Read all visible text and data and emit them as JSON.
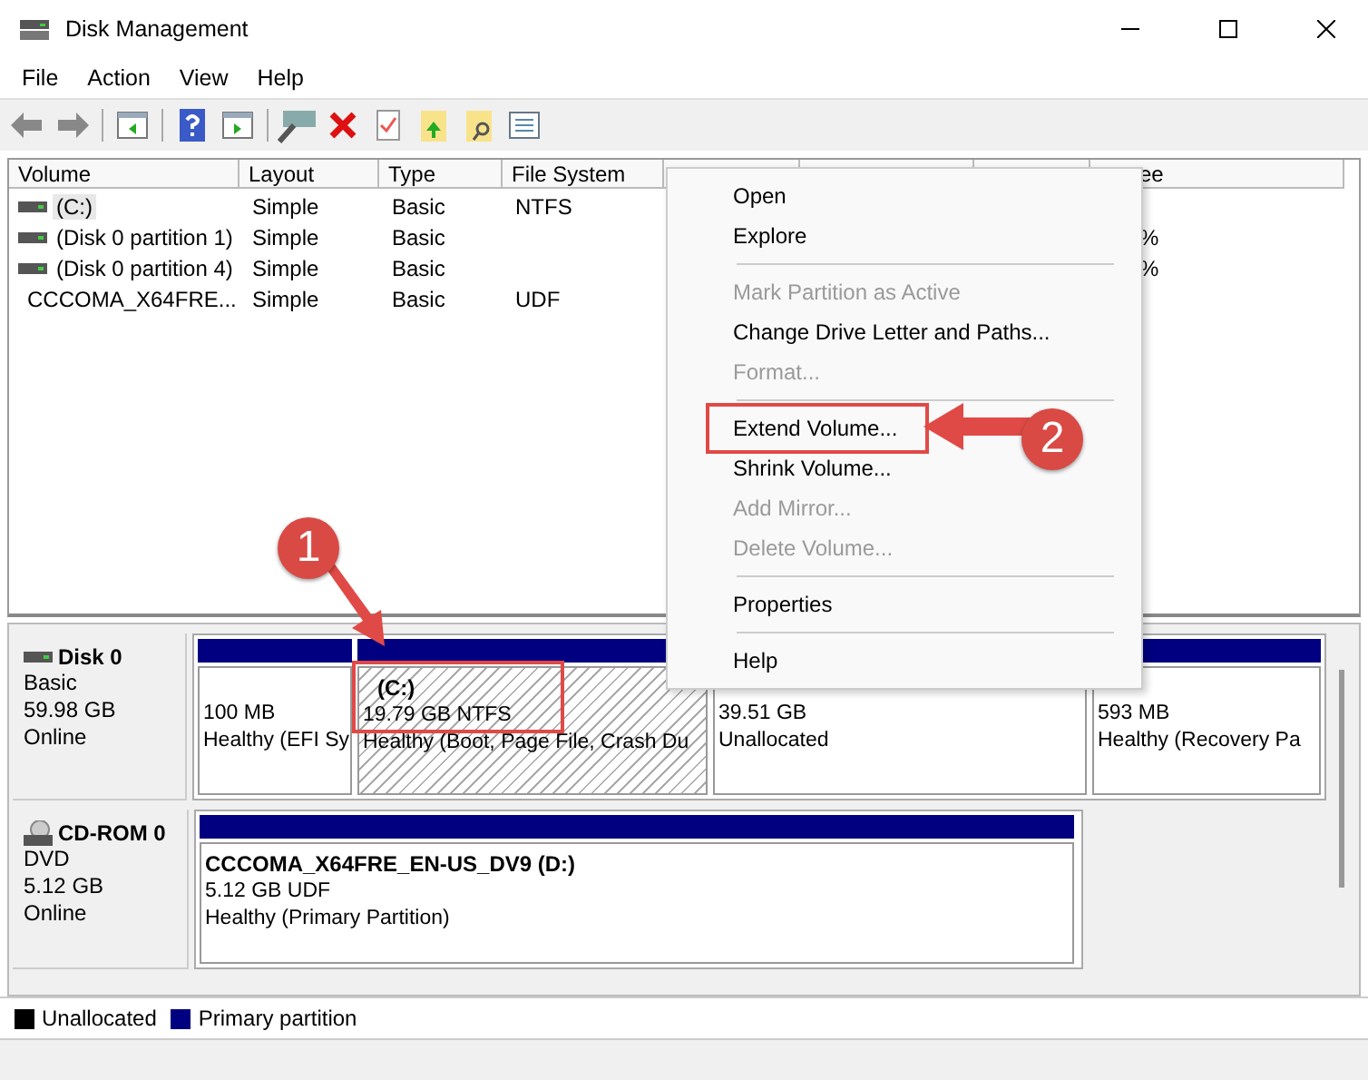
{
  "window": {
    "title": "Disk Management"
  },
  "menu_bar": [
    "File",
    "Action",
    "View",
    "Help"
  ],
  "table": {
    "columns": [
      {
        "label": "Volume"
      },
      {
        "label": "Layout"
      },
      {
        "label": "Type"
      },
      {
        "label": "File System"
      },
      {},
      {},
      {},
      {
        "label": "ee"
      }
    ],
    "rows": [
      {
        "kind": "disk",
        "cells": [
          "(C:)",
          "Simple",
          "Basic",
          "NTFS",
          "",
          "",
          "",
          ""
        ],
        "selected": true
      },
      {
        "kind": "disk",
        "cells": [
          "(Disk 0 partition 1)",
          "Simple",
          "Basic",
          "",
          "",
          "",
          "",
          "%"
        ],
        "selected": false
      },
      {
        "kind": "disk",
        "cells": [
          "(Disk 0 partition 4)",
          "Simple",
          "Basic",
          "",
          "",
          "",
          "",
          "%"
        ],
        "selected": false
      },
      {
        "kind": "cd",
        "cells": [
          "CCCOMA_X64FRE...",
          "Simple",
          "Basic",
          "UDF",
          "",
          "",
          "",
          ""
        ],
        "selected": false
      }
    ]
  },
  "disks": [
    {
      "kind": "disk",
      "name": "Disk 0",
      "lines": [
        "Basic",
        "59.98 GB",
        "Online"
      ],
      "partitions": [
        {
          "kind": "primary",
          "lines": [
            "100 MB",
            "Healthy (EFI Sy"
          ],
          "selected": false
        },
        {
          "kind": "primary",
          "title": "(C:)",
          "lines": [
            "19.79 GB NTFS",
            "Healthy (Boot, Page File, Crash Du"
          ],
          "selected": true
        },
        {
          "kind": "unallocated",
          "lines": [
            "39.51 GB",
            "Unallocated"
          ],
          "selected": false
        },
        {
          "kind": "primary",
          "lines": [
            "593 MB",
            "Healthy (Recovery Pa"
          ],
          "selected": false
        }
      ]
    },
    {
      "kind": "cd",
      "name": "CD-ROM 0",
      "lines": [
        "DVD",
        "5.12 GB",
        "Online"
      ],
      "partitions": [
        {
          "kind": "primary",
          "title": "CCCOMA_X64FRE_EN-US_DV9  (D:)",
          "lines": [
            "5.12 GB UDF",
            "Healthy (Primary Partition)"
          ],
          "selected": false
        }
      ]
    }
  ],
  "legend": [
    {
      "label": "Unallocated",
      "color": "#000000"
    },
    {
      "label": "Primary partition",
      "color": "#000080"
    }
  ],
  "context_menu": [
    {
      "kind": "item",
      "label": "Open",
      "disabled": false
    },
    {
      "kind": "item",
      "label": "Explore",
      "disabled": false
    },
    {
      "kind": "separator"
    },
    {
      "kind": "item",
      "label": "Mark Partition as Active",
      "disabled": true
    },
    {
      "kind": "item",
      "label": "Change Drive Letter and Paths...",
      "disabled": false
    },
    {
      "kind": "item",
      "label": "Format...",
      "disabled": true
    },
    {
      "kind": "separator"
    },
    {
      "kind": "item",
      "label": "Extend Volume...",
      "disabled": false
    },
    {
      "kind": "item",
      "label": "Shrink Volume...",
      "disabled": false
    },
    {
      "kind": "item",
      "label": "Add Mirror...",
      "disabled": true
    },
    {
      "kind": "item",
      "label": "Delete Volume...",
      "disabled": true
    },
    {
      "kind": "separator"
    },
    {
      "kind": "item",
      "label": "Properties",
      "disabled": false
    },
    {
      "kind": "separator"
    },
    {
      "kind": "item",
      "label": "Help",
      "disabled": false
    }
  ],
  "callouts": [
    {
      "number": "1"
    },
    {
      "number": "2"
    }
  ]
}
